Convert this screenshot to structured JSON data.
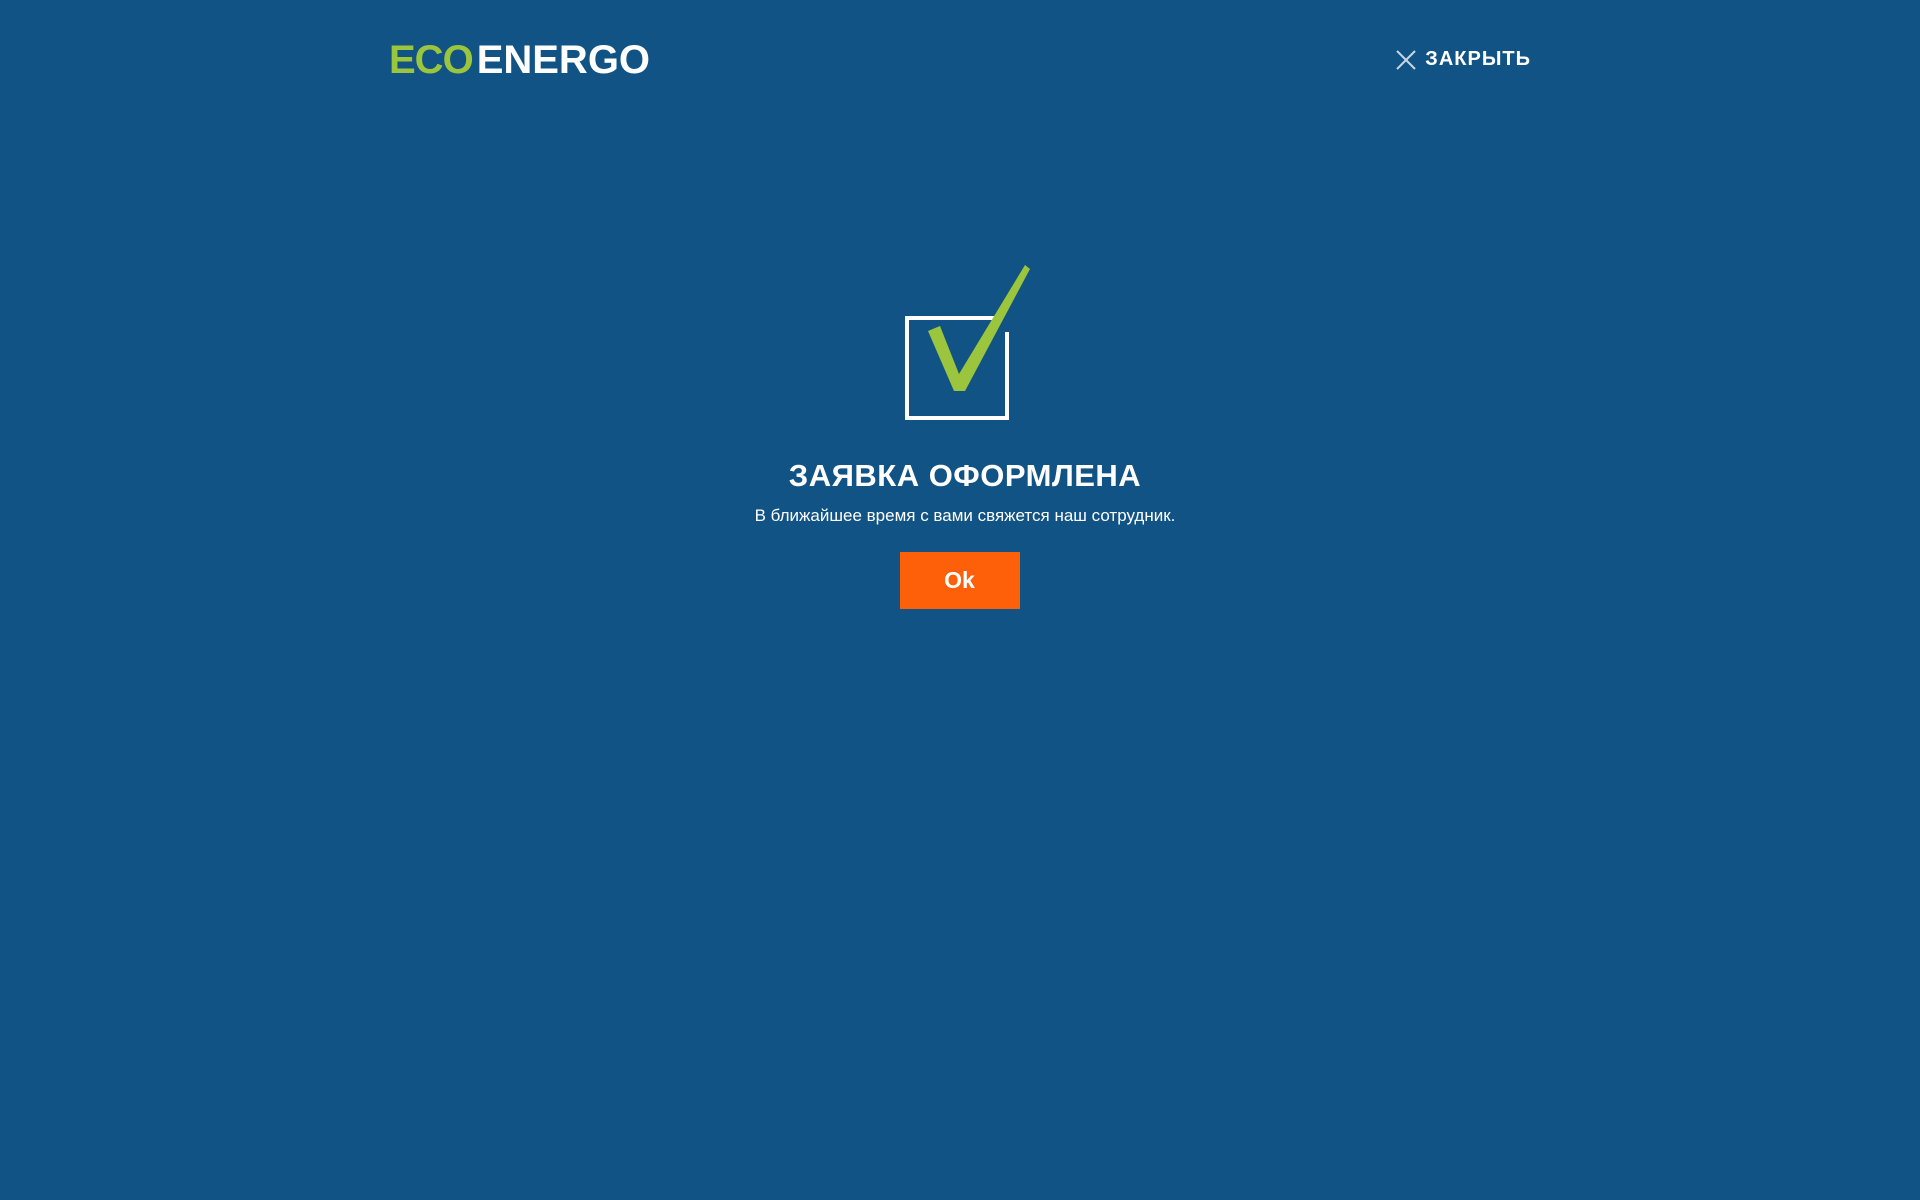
{
  "header": {
    "logo": {
      "eco_text": "ECO",
      "energo_text": "ENERGO"
    },
    "close": {
      "label": "ЗАКРЫТЬ",
      "icon": "close-icon"
    }
  },
  "confirmation": {
    "icon": "checkmark-box-icon",
    "title": "ЗАЯВКА ОФОРМЛЕНА",
    "message": "В ближайшее время с вами свяжется наш сотрудник.",
    "ok_label": "Ok"
  },
  "colors": {
    "background": "#115384",
    "accent_green": "#9bc53d",
    "button_orange": "#fe5f09",
    "text": "#ffffff"
  }
}
